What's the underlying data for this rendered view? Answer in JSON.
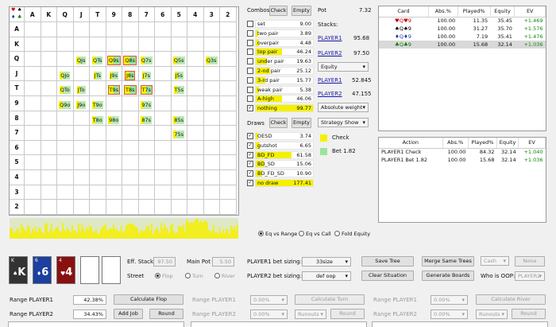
{
  "grid": {
    "ranks": [
      "A",
      "K",
      "Q",
      "J",
      "T",
      "9",
      "8",
      "7",
      "6",
      "5",
      "4",
      "3",
      "2"
    ],
    "corner_suits": [
      "♥",
      "♠",
      "♦",
      "♣"
    ],
    "combos": [
      [
        "Q",
        "J",
        "QJs"
      ],
      [
        "Q",
        "T",
        "QTs"
      ],
      [
        "Q",
        "9",
        "Q9s"
      ],
      [
        "Q",
        "8",
        "Q8s"
      ],
      [
        "Q",
        "7",
        "Q7s"
      ],
      [
        "Q",
        "5",
        "Q5s"
      ],
      [
        "Q",
        "3",
        "Q3s"
      ],
      [
        "J",
        "Q",
        "QJo"
      ],
      [
        "J",
        "T",
        "JTs"
      ],
      [
        "J",
        "9",
        "J9s"
      ],
      [
        "J",
        "8",
        "J8s"
      ],
      [
        "J",
        "7",
        "J7s"
      ],
      [
        "J",
        "5",
        "J5s"
      ],
      [
        "T",
        "Q",
        "QTo"
      ],
      [
        "T",
        "J",
        "JTo"
      ],
      [
        "T",
        "9",
        "T9s"
      ],
      [
        "T",
        "8",
        "T8s"
      ],
      [
        "T",
        "7",
        "T7s"
      ],
      [
        "T",
        "5",
        "T5s"
      ],
      [
        "9",
        "Q",
        "Q9o"
      ],
      [
        "9",
        "J",
        "J9o"
      ],
      [
        "9",
        "T",
        "T9o"
      ],
      [
        "9",
        "7",
        "97s"
      ],
      [
        "8",
        "T",
        "T8o"
      ],
      [
        "8",
        "9",
        "98o"
      ],
      [
        "8",
        "7",
        "87s"
      ],
      [
        "8",
        "5",
        "85s"
      ],
      [
        "7",
        "5",
        "75s"
      ]
    ],
    "highlight": [
      "Q9s",
      "Q8s",
      "J8s",
      "T9s",
      "T8s",
      "T7s"
    ]
  },
  "combos_section": {
    "title": "Combos",
    "check": "Check",
    "empty": "Empty",
    "rows": [
      {
        "label": "set",
        "value": "9.00",
        "fill": 0.0,
        "checked": false
      },
      {
        "label": "two pair",
        "value": "3.89",
        "fill": 0.04,
        "checked": false
      },
      {
        "label": "overpair",
        "value": "4.48",
        "fill": 0.05,
        "checked": false
      },
      {
        "label": "top pair",
        "value": "46.24",
        "fill": 0.46,
        "checked": false
      },
      {
        "label": "under pair",
        "value": "19.63",
        "fill": 0.2,
        "checked": false
      },
      {
        "label": "2-nd pair",
        "value": "25.12",
        "fill": 0.25,
        "checked": false
      },
      {
        "label": "3-rd pair",
        "value": "15.77",
        "fill": 0.16,
        "checked": false
      },
      {
        "label": "weak pair",
        "value": "5.38",
        "fill": 0.05,
        "checked": false
      },
      {
        "label": "A-high",
        "value": "46.06",
        "fill": 0.46,
        "checked": false
      },
      {
        "label": "nothing",
        "value": "99.77",
        "fill": 1.0,
        "checked": true
      }
    ]
  },
  "draws_section": {
    "title": "Draws",
    "check": "Check",
    "empty": "Empty",
    "rows": [
      {
        "label": "OESD",
        "value": "3.74",
        "fill": 0.04,
        "checked": true
      },
      {
        "label": "gutshot",
        "value": "6.65",
        "fill": 0.07,
        "checked": true
      },
      {
        "label": "BD_FD",
        "value": "61.58",
        "fill": 0.62,
        "checked": true
      },
      {
        "label": "BD_SD",
        "value": "15.06",
        "fill": 0.15,
        "checked": true
      },
      {
        "label": "BD_FD_SD",
        "value": "10.90",
        "fill": 0.11,
        "checked": true
      },
      {
        "label": "no draw",
        "value": "177.41",
        "fill": 1.0,
        "checked": true
      }
    ]
  },
  "pot": {
    "label": "Pot",
    "value": "7.32"
  },
  "stacks": {
    "label": "Stacks:",
    "p1": "PLAYER1",
    "p1_val": "95.68",
    "p2": "PLAYER2",
    "p2_val": "97.50",
    "equity_dd": "Equity",
    "p1b": "PLAYER1",
    "p1b_val": "52.845",
    "p2b": "PLAYER2",
    "p2b_val": "47.155",
    "weight_dd": "Absolute weight",
    "strategy_dd": "Strategy Show"
  },
  "legend": {
    "check": "Check",
    "bet": "Bet 1.82",
    "check_color": "#f5f000",
    "bet_color": "#9be39b"
  },
  "card_table": {
    "headers": [
      "Card",
      "Abs.%",
      "Played%",
      "Equity",
      "EV"
    ],
    "rows": [
      {
        "card": "♥Q♥9",
        "abs": "100.00",
        "played": "11.35",
        "equity": "35.45",
        "ev": "+1.469",
        "sel": false
      },
      {
        "card": "♠Q♠9",
        "abs": "100.00",
        "played": "31.27",
        "equity": "35.70",
        "ev": "+1.576",
        "sel": false
      },
      {
        "card": "♦Q♦9",
        "abs": "100.00",
        "played": "7.19",
        "equity": "35.41",
        "ev": "+1.476",
        "sel": false
      },
      {
        "card": "♣Q♣9",
        "abs": "100.00",
        "played": "15.68",
        "equity": "32.14",
        "ev": "+1.036",
        "sel": true
      }
    ]
  },
  "action_table": {
    "headers": [
      "Action",
      "Abs.%",
      "Played%",
      "Equity",
      "EV"
    ],
    "rows": [
      {
        "action": "PLAYER1 Check",
        "abs": "100.00",
        "played": "84.32",
        "equity": "32.14",
        "ev": "+1.040"
      },
      {
        "action": "PLAYER1 Bet 1.82",
        "abs": "100.00",
        "played": "15.68",
        "equity": "32.14",
        "ev": "+1.036"
      }
    ]
  },
  "eq_radios": [
    "Eq vs Range",
    "Eq vs Call",
    "Fold Equity"
  ],
  "board": [
    {
      "rank": "K",
      "suit": "♠",
      "corner": "K",
      "color": "#333333"
    },
    {
      "rank": "6",
      "suit": "♦",
      "corner": "6",
      "color": "#1c3fa0"
    },
    {
      "rank": "4",
      "suit": "♥",
      "corner": "4",
      "color": "#8a1010"
    }
  ],
  "controls": {
    "eff_stack_label": "Eff. Stack",
    "eff_stack": "97.50",
    "main_pot_label": "Main Pot",
    "main_pot": "5.50",
    "street_label": "Street",
    "streets": [
      "Flop",
      "Turn",
      "River"
    ],
    "p1_sizing_label": "PLAYER1 bet sizing:",
    "p1_sizing": "33size",
    "p2_sizing_label": "PLAYER2 bet sizing:",
    "p2_sizing": "def oop",
    "save_tree": "Save Tree",
    "clear_situation": "Clear Situation",
    "merge": "Merge Same Trees",
    "gen_boards": "Generate Boards",
    "cash": "Cash",
    "none": "None",
    "who_oop": "Who is OOP:",
    "who_oop_val": "PLAYER2"
  },
  "bottom": {
    "range_p1": "Range PLAYER1",
    "range_p1_val": "42.38%",
    "range_p2": "Range PLAYER2",
    "range_p2_val": "34.43%",
    "calc_flop": "Calculate Flop",
    "add_job": "Add Job",
    "round": "Round",
    "turn_p1": "Range PLAYER1",
    "turn_p1_val": "0.00%",
    "turn_p2": "Range PLAYER2",
    "turn_p2_val": "0.00%",
    "calc_turn": "Calculate Turn",
    "runouts": "Runouts",
    "round2": "Round",
    "river_p1": "Range PLAYER1",
    "river_p1_val": "0.00%",
    "river_p2": "Range PLAYER2",
    "river_p2_val": "0.00%",
    "calc_river": "Calculate River",
    "runouts2": "Runouts",
    "round3": "Round"
  }
}
